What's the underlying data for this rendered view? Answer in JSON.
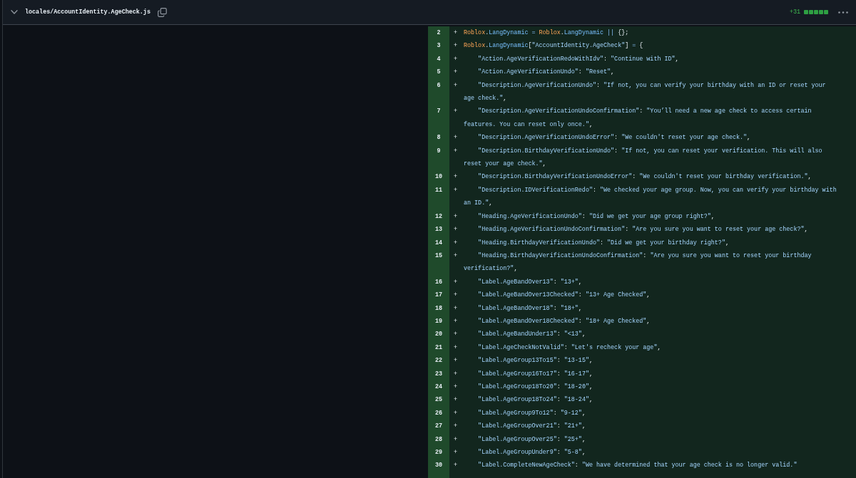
{
  "file_header": {
    "expanded": true,
    "path": "locales/AccountIdentity.AgeCheck.js",
    "additions": "+31",
    "diffstat": [
      {
        "kind": "added"
      },
      {
        "kind": "added"
      },
      {
        "kind": "added"
      },
      {
        "kind": "added"
      },
      {
        "kind": "added"
      }
    ]
  },
  "diff_lines": [
    {
      "number": "2",
      "marker": "+",
      "tokens": [
        {
          "kind": "variable",
          "text": "Roblox"
        },
        {
          "kind": "punctuation",
          "text": "."
        },
        {
          "kind": "property",
          "text": "LangDynamic"
        },
        {
          "kind": "operator",
          "text": " = "
        },
        {
          "kind": "variable",
          "text": "Roblox"
        },
        {
          "kind": "punctuation",
          "text": "."
        },
        {
          "kind": "property",
          "text": "LangDynamic"
        },
        {
          "kind": "operator",
          "text": " || "
        },
        {
          "kind": "punctuation",
          "text": "{};"
        }
      ]
    },
    {
      "number": "3",
      "marker": "+",
      "tokens": [
        {
          "kind": "variable",
          "text": "Roblox"
        },
        {
          "kind": "punctuation",
          "text": "."
        },
        {
          "kind": "property",
          "text": "LangDynamic"
        },
        {
          "kind": "punctuation",
          "text": "["
        },
        {
          "kind": "string",
          "text": "\"AccountIdentity.AgeCheck\""
        },
        {
          "kind": "punctuation",
          "text": "]"
        },
        {
          "kind": "operator",
          "text": " = "
        },
        {
          "kind": "punctuation",
          "text": "{"
        }
      ]
    },
    {
      "number": "4",
      "marker": "+",
      "tokens": [
        {
          "kind": "string",
          "text": "    \"Action.AgeVerificationRedoWithIdv\""
        },
        {
          "kind": "punctuation",
          "text": ": "
        },
        {
          "kind": "string",
          "text": "\"Continue with ID\""
        },
        {
          "kind": "punctuation",
          "text": ","
        }
      ]
    },
    {
      "number": "5",
      "marker": "+",
      "tokens": [
        {
          "kind": "string",
          "text": "    \"Action.AgeVerificationUndo\""
        },
        {
          "kind": "punctuation",
          "text": ": "
        },
        {
          "kind": "string",
          "text": "\"Reset\""
        },
        {
          "kind": "punctuation",
          "text": ","
        }
      ]
    },
    {
      "number": "6",
      "marker": "+",
      "tokens": [
        {
          "kind": "string",
          "text": "    \"Description.AgeVerificationUndo\""
        },
        {
          "kind": "punctuation",
          "text": ": "
        },
        {
          "kind": "string",
          "text": "\"If not, you can verify your birthday with an ID or reset your age check.\""
        },
        {
          "kind": "punctuation",
          "text": ","
        }
      ]
    },
    {
      "number": "7",
      "marker": "+",
      "tokens": [
        {
          "kind": "string",
          "text": "    \"Description.AgeVerificationUndoConfirmation\""
        },
        {
          "kind": "punctuation",
          "text": ": "
        },
        {
          "kind": "string",
          "text": "\"You’ll need a new age check to access certain features. You can reset only once.\""
        },
        {
          "kind": "punctuation",
          "text": ","
        }
      ]
    },
    {
      "number": "8",
      "marker": "+",
      "tokens": [
        {
          "kind": "string",
          "text": "    \"Description.AgeVerificationUndoError\""
        },
        {
          "kind": "punctuation",
          "text": ": "
        },
        {
          "kind": "string",
          "text": "\"We couldn't reset your age check.\""
        },
        {
          "kind": "punctuation",
          "text": ","
        }
      ]
    },
    {
      "number": "9",
      "marker": "+",
      "tokens": [
        {
          "kind": "string",
          "text": "    \"Description.BirthdayVerificationUndo\""
        },
        {
          "kind": "punctuation",
          "text": ": "
        },
        {
          "kind": "string",
          "text": "\"If not, you can reset your verification. This will also reset your age check.\""
        },
        {
          "kind": "punctuation",
          "text": ","
        }
      ]
    },
    {
      "number": "10",
      "marker": "+",
      "tokens": [
        {
          "kind": "string",
          "text": "    \"Description.BirthdayVerificationUndoError\""
        },
        {
          "kind": "punctuation",
          "text": ": "
        },
        {
          "kind": "string",
          "text": "\"We couldn't reset your birthday verification.\""
        },
        {
          "kind": "punctuation",
          "text": ","
        }
      ]
    },
    {
      "number": "11",
      "marker": "+",
      "tokens": [
        {
          "kind": "string",
          "text": "    \"Description.IDVerificationRedo\""
        },
        {
          "kind": "punctuation",
          "text": ": "
        },
        {
          "kind": "string",
          "text": "\"We checked your age group. Now, you can verify your birthday with an ID.\""
        },
        {
          "kind": "punctuation",
          "text": ","
        }
      ]
    },
    {
      "number": "12",
      "marker": "+",
      "tokens": [
        {
          "kind": "string",
          "text": "    \"Heading.AgeVerificationUndo\""
        },
        {
          "kind": "punctuation",
          "text": ": "
        },
        {
          "kind": "string",
          "text": "\"Did we get your age group right?\""
        },
        {
          "kind": "punctuation",
          "text": ","
        }
      ]
    },
    {
      "number": "13",
      "marker": "+",
      "tokens": [
        {
          "kind": "string",
          "text": "    \"Heading.AgeVerificationUndoConfirmation\""
        },
        {
          "kind": "punctuation",
          "text": ": "
        },
        {
          "kind": "string",
          "text": "\"Are you sure you want to reset your age check?\""
        },
        {
          "kind": "punctuation",
          "text": ","
        }
      ]
    },
    {
      "number": "14",
      "marker": "+",
      "tokens": [
        {
          "kind": "string",
          "text": "    \"Heading.BirthdayVerificationUndo\""
        },
        {
          "kind": "punctuation",
          "text": ": "
        },
        {
          "kind": "string",
          "text": "\"Did we get your birthday right?\""
        },
        {
          "kind": "punctuation",
          "text": ","
        }
      ]
    },
    {
      "number": "15",
      "marker": "+",
      "tokens": [
        {
          "kind": "string",
          "text": "    \"Heading.BirthdayVerificationUndoConfirmation\""
        },
        {
          "kind": "punctuation",
          "text": ": "
        },
        {
          "kind": "string",
          "text": "\"Are you sure you want to reset your birthday verification?\""
        },
        {
          "kind": "punctuation",
          "text": ","
        }
      ]
    },
    {
      "number": "16",
      "marker": "+",
      "tokens": [
        {
          "kind": "string",
          "text": "    \"Label.AgeBandOver13\""
        },
        {
          "kind": "punctuation",
          "text": ": "
        },
        {
          "kind": "string",
          "text": "\"13+\""
        },
        {
          "kind": "punctuation",
          "text": ","
        }
      ]
    },
    {
      "number": "17",
      "marker": "+",
      "tokens": [
        {
          "kind": "string",
          "text": "    \"Label.AgeBandOver13Checked\""
        },
        {
          "kind": "punctuation",
          "text": ": "
        },
        {
          "kind": "string",
          "text": "\"13+ Age Checked\""
        },
        {
          "kind": "punctuation",
          "text": ","
        }
      ]
    },
    {
      "number": "18",
      "marker": "+",
      "tokens": [
        {
          "kind": "string",
          "text": "    \"Label.AgeBandOver18\""
        },
        {
          "kind": "punctuation",
          "text": ": "
        },
        {
          "kind": "string",
          "text": "\"18+\""
        },
        {
          "kind": "punctuation",
          "text": ","
        }
      ]
    },
    {
      "number": "19",
      "marker": "+",
      "tokens": [
        {
          "kind": "string",
          "text": "    \"Label.AgeBandOver18Checked\""
        },
        {
          "kind": "punctuation",
          "text": ": "
        },
        {
          "kind": "string",
          "text": "\"18+ Age Checked\""
        },
        {
          "kind": "punctuation",
          "text": ","
        }
      ]
    },
    {
      "number": "20",
      "marker": "+",
      "tokens": [
        {
          "kind": "string",
          "text": "    \"Label.AgeBandUnder13\""
        },
        {
          "kind": "punctuation",
          "text": ": "
        },
        {
          "kind": "string",
          "text": "\"<13\""
        },
        {
          "kind": "punctuation",
          "text": ","
        }
      ]
    },
    {
      "number": "21",
      "marker": "+",
      "tokens": [
        {
          "kind": "string",
          "text": "    \"Label.AgeCheckNotValid\""
        },
        {
          "kind": "punctuation",
          "text": ": "
        },
        {
          "kind": "string",
          "text": "\"Let's recheck your age\""
        },
        {
          "kind": "punctuation",
          "text": ","
        }
      ]
    },
    {
      "number": "22",
      "marker": "+",
      "tokens": [
        {
          "kind": "string",
          "text": "    \"Label.AgeGroup13To15\""
        },
        {
          "kind": "punctuation",
          "text": ": "
        },
        {
          "kind": "string",
          "text": "\"13-15\""
        },
        {
          "kind": "punctuation",
          "text": ","
        }
      ]
    },
    {
      "number": "23",
      "marker": "+",
      "tokens": [
        {
          "kind": "string",
          "text": "    \"Label.AgeGroup16To17\""
        },
        {
          "kind": "punctuation",
          "text": ": "
        },
        {
          "kind": "string",
          "text": "\"16-17\""
        },
        {
          "kind": "punctuation",
          "text": ","
        }
      ]
    },
    {
      "number": "24",
      "marker": "+",
      "tokens": [
        {
          "kind": "string",
          "text": "    \"Label.AgeGroup18To20\""
        },
        {
          "kind": "punctuation",
          "text": ": "
        },
        {
          "kind": "string",
          "text": "\"18-20\""
        },
        {
          "kind": "punctuation",
          "text": ","
        }
      ]
    },
    {
      "number": "25",
      "marker": "+",
      "tokens": [
        {
          "kind": "string",
          "text": "    \"Label.AgeGroup18To24\""
        },
        {
          "kind": "punctuation",
          "text": ": "
        },
        {
          "kind": "string",
          "text": "\"18-24\""
        },
        {
          "kind": "punctuation",
          "text": ","
        }
      ]
    },
    {
      "number": "26",
      "marker": "+",
      "tokens": [
        {
          "kind": "string",
          "text": "    \"Label.AgeGroup9To12\""
        },
        {
          "kind": "punctuation",
          "text": ": "
        },
        {
          "kind": "string",
          "text": "\"9-12\""
        },
        {
          "kind": "punctuation",
          "text": ","
        }
      ]
    },
    {
      "number": "27",
      "marker": "+",
      "tokens": [
        {
          "kind": "string",
          "text": "    \"Label.AgeGroupOver21\""
        },
        {
          "kind": "punctuation",
          "text": ": "
        },
        {
          "kind": "string",
          "text": "\"21+\""
        },
        {
          "kind": "punctuation",
          "text": ","
        }
      ]
    },
    {
      "number": "28",
      "marker": "+",
      "tokens": [
        {
          "kind": "string",
          "text": "    \"Label.AgeGroupOver25\""
        },
        {
          "kind": "punctuation",
          "text": ": "
        },
        {
          "kind": "string",
          "text": "\"25+\""
        },
        {
          "kind": "punctuation",
          "text": ","
        }
      ]
    },
    {
      "number": "29",
      "marker": "+",
      "tokens": [
        {
          "kind": "string",
          "text": "    \"Label.AgeGroupUnder9\""
        },
        {
          "kind": "punctuation",
          "text": ": "
        },
        {
          "kind": "string",
          "text": "\"5-8\""
        },
        {
          "kind": "punctuation",
          "text": ","
        }
      ]
    },
    {
      "number": "30",
      "marker": "+",
      "tokens": [
        {
          "kind": "string",
          "text": "    \"Label.CompleteNewAgeCheck\""
        },
        {
          "kind": "punctuation",
          "text": ": "
        },
        {
          "kind": "string",
          "text": "\"We have determined that your age check is no longer valid.\""
        }
      ]
    }
  ]
}
